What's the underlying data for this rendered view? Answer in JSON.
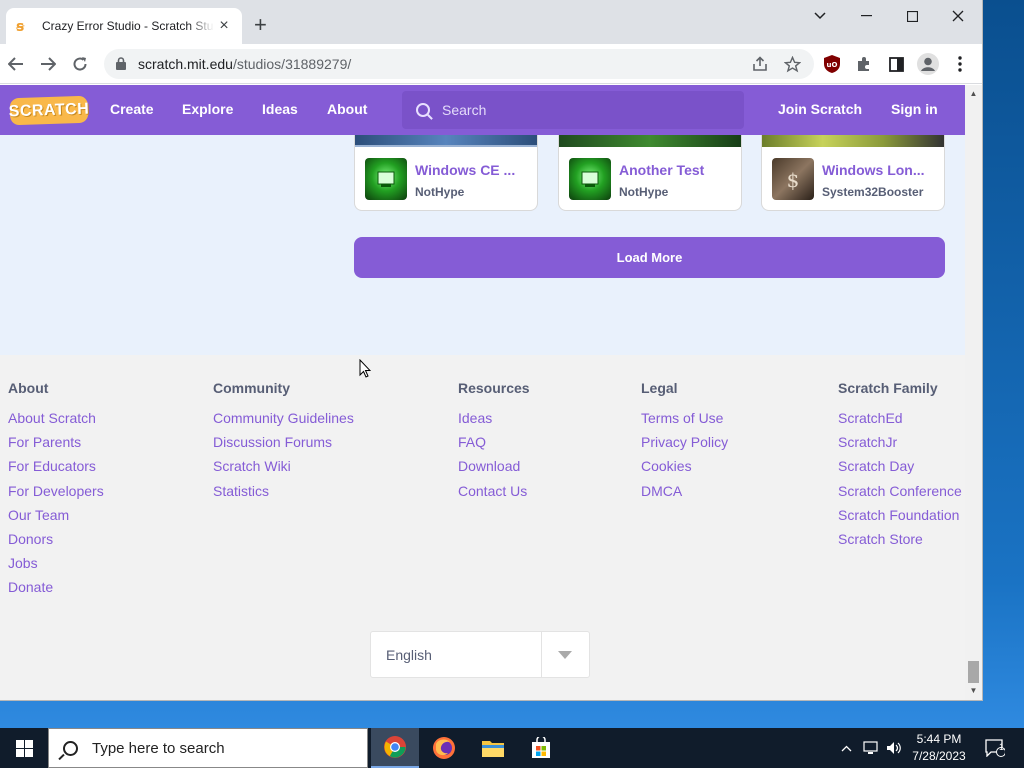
{
  "browser": {
    "tab_title": "Crazy Error Studio - Scratch Studio",
    "url_host": "scratch.mit.edu",
    "url_path": "/studios/31889279/"
  },
  "scratch_nav": {
    "logo": "SCRATCH",
    "links": [
      "Create",
      "Explore",
      "Ideas",
      "About"
    ],
    "search_placeholder": "Search",
    "join": "Join Scratch",
    "signin": "Sign in"
  },
  "projects": [
    {
      "title": "Windows CE ...",
      "author": "NotHype"
    },
    {
      "title": "Another Test",
      "author": "NotHype"
    },
    {
      "title": "Windows Lon...",
      "author": "System32Booster"
    }
  ],
  "load_more": "Load More",
  "footer": {
    "columns": [
      {
        "heading": "About",
        "links": [
          "About Scratch",
          "For Parents",
          "For Educators",
          "For Developers",
          "Our Team",
          "Donors",
          "Jobs",
          "Donate"
        ]
      },
      {
        "heading": "Community",
        "links": [
          "Community Guidelines",
          "Discussion Forums",
          "Scratch Wiki",
          "Statistics"
        ]
      },
      {
        "heading": "Resources",
        "links": [
          "Ideas",
          "FAQ",
          "Download",
          "Contact Us"
        ]
      },
      {
        "heading": "Legal",
        "links": [
          "Terms of Use",
          "Privacy Policy",
          "Cookies",
          "DMCA"
        ]
      },
      {
        "heading": "Scratch Family",
        "links": [
          "ScratchEd",
          "ScratchJr",
          "Scratch Day",
          "Scratch Conference",
          "Scratch Foundation",
          "Scratch Store"
        ]
      }
    ],
    "language": "English"
  },
  "taskbar": {
    "search_placeholder": "Type here to search",
    "time": "5:44 PM",
    "date": "7/28/2023",
    "notification_count": "1"
  },
  "colors": {
    "scratch_purple": "#855cd6",
    "footer_bg": "#f2f2f2",
    "page_bg": "#e9f1fc"
  }
}
